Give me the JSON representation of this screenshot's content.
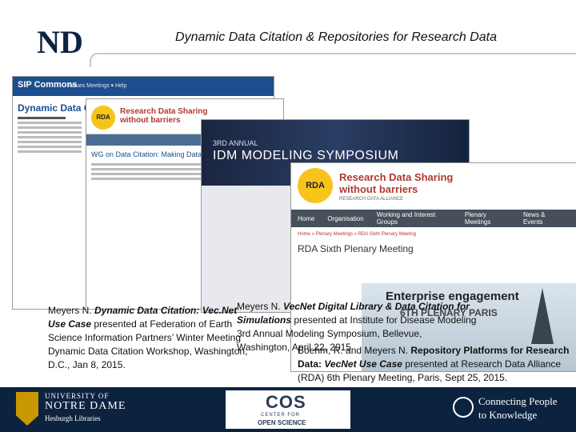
{
  "header": {
    "logo_text": "ND",
    "title": "Dynamic Data Citation & Repositories for Research Data"
  },
  "screenshots": {
    "sip": {
      "brand": "SIP Commons",
      "nav": "Issues   Meetings ▾   Help",
      "heading": "Dynamic Data Citation"
    },
    "rda_small": {
      "badge": "RDA",
      "title_line1": "Research Data Sharing",
      "title_line2": "without barriers",
      "heading": "WG on Data Citation: Making Data Citable"
    },
    "idm": {
      "line1": "3RD ANNUAL",
      "line2": "IDM MODELING SYMPOSIUM"
    },
    "rda_large": {
      "badge": "RDA",
      "title_line1": "Research Data Sharing",
      "title_line2": "without barriers",
      "subtitle": "RESEARCH DATA ALLIANCE",
      "nav": [
        "Home",
        "Organisation",
        "Working and Interest Groups",
        "Plenary Meetings",
        "News & Events"
      ],
      "crumb": "Home » Plenary Meetings » RDA Sixth Plenary Meeting",
      "heading": "RDA Sixth Plenary Meeting",
      "promo1": "Enterprise engagement",
      "promo2": "6TH PLENARY  PARIS"
    }
  },
  "citations": {
    "c1": {
      "pre": "Meyers N. ",
      "bold": "Dynamic Data Citation: Vec.Net Use Case",
      "post": " presented at Federation of Earth Science Information Partners’ Winter Meeting Dynamic Data Citation Workshop, Washington, D.C., Jan 8, 2015."
    },
    "c2": {
      "pre": "Meyers N. ",
      "bold": "VecNet Digital Library & Data Citation for Simulations",
      "post": " presented at Institute for Disease Modeling 3rd Annual Modeling Symposium, Bellevue, Washington, April 22, 2015"
    },
    "c3": {
      "pre": "Boehm, R. and Meyers N. ",
      "bold": "Repository Platforms for Research Data: ",
      "bolditalic": "VecNet Use Case",
      "post": " presented at Research Data Alliance (RDA) 6th Plenary Meeting, Paris, Sept 25, 2015."
    }
  },
  "footer": {
    "nd_line1": "UNIVERSITY OF",
    "nd_line2": "NOTRE DAME",
    "nd_line3": "Hesburgh Libraries",
    "cos_logo": "COS",
    "cos_line1": "CENTER FOR",
    "cos_line2": "OPEN SCIENCE",
    "conn_line1": "Connecting People",
    "conn_line2": "to Knowledge"
  },
  "colors": {
    "navy": "#0c2340",
    "gold": "#c99700",
    "rda_red": "#b03a32",
    "rda_yellow": "#f7c41b"
  }
}
